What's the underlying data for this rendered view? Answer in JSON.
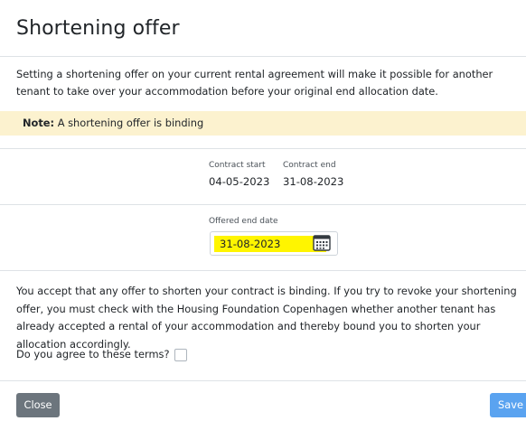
{
  "modal": {
    "title": "Shortening offer",
    "intro": "Setting a shortening offer on your current rental agreement will make it possible for another tenant to take over your accommodation before your original end allocation date.",
    "note_label": "Note:",
    "note_text": " A shortening offer is binding",
    "contract_start_label": "Contract start",
    "contract_start_value": "04-05-2023",
    "contract_end_label": "Contract end",
    "contract_end_value": "31-08-2023",
    "offered_end_label": "Offered end date",
    "offered_end_value": "31-08-2023",
    "calendar_icon": "calendar-icon",
    "terms": "You accept that any offer to shorten your contract is binding. If you try to revoke your shortening offer, you must check with the Housing Foundation Copenhagen whether another tenant has already accepted a rental of your accommodation and thereby bound you to shorten your allocation accordingly.",
    "agree_label": "Do you agree to these terms?",
    "agree_checked": false,
    "close_label": "Close",
    "save_label": "Save"
  },
  "colors": {
    "note_bg": "#fcf2cf",
    "highlight": "#fff500",
    "close_bg": "#6c757d",
    "save_bg": "#5aa3f0"
  }
}
